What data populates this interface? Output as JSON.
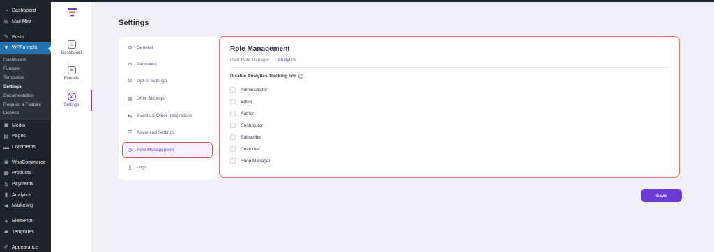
{
  "wp_menu": {
    "dashboard": "Dashboard",
    "mail_mint": "Mail Mint",
    "posts": "Posts",
    "wpfunnels": "WPFunnels",
    "submenu": [
      "Dashboard",
      "Funnels",
      "Templates",
      "Settings",
      "Documentation",
      "Request a Feature",
      "License"
    ],
    "media": "Media",
    "pages": "Pages",
    "comments": "Comments",
    "woocommerce": "WooCommerce",
    "products": "Products",
    "payments": "Payments",
    "analytics": "Analytics",
    "marketing": "Marketing",
    "elementor": "Elementor",
    "templates": "Templates",
    "appearance": "Appearance"
  },
  "rail": {
    "dashboard": "Dashboard",
    "funnels": "Funnels",
    "settings": "Settings"
  },
  "page": {
    "title": "Settings"
  },
  "settings_nav": {
    "general": "General",
    "permalink": "Permalink",
    "optin": "Opt-in Settings",
    "offer": "Offer Settings",
    "events": "Events & Other Integrations",
    "advanced": "Advanced Settings",
    "role": "Role Management",
    "logs": "Logs"
  },
  "panel": {
    "title": "Role Management",
    "tabs": [
      "User Role Manager",
      "Analytics"
    ],
    "section_label": "Disable Analytics Tracking For",
    "roles": [
      "Administrator",
      "Editor",
      "Author",
      "Contributor",
      "Subscriber",
      "Customer",
      "Shop Manager"
    ]
  },
  "actions": {
    "save": "Save"
  },
  "colors": {
    "accent": "#6c3bd5",
    "wp_active": "#2271b1",
    "highlight_border": "#d9534f"
  }
}
